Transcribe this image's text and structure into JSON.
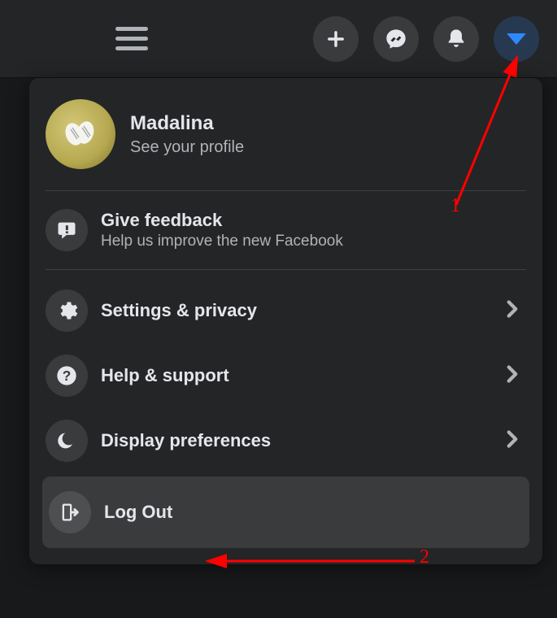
{
  "topbar": {
    "menu_icon": "hamburger",
    "buttons": [
      "create",
      "messenger",
      "notifications",
      "account"
    ]
  },
  "profile": {
    "name": "Madalina",
    "subtitle": "See your profile"
  },
  "feedback": {
    "title": "Give feedback",
    "subtitle": "Help us improve the new Facebook"
  },
  "menu": [
    {
      "icon": "gear",
      "label": "Settings & privacy",
      "chevron": true
    },
    {
      "icon": "question",
      "label": "Help & support",
      "chevron": true
    },
    {
      "icon": "moon",
      "label": "Display preferences",
      "chevron": true
    }
  ],
  "logout": {
    "label": "Log Out"
  },
  "annotations": {
    "arrow1_label": "1",
    "arrow2_label": "2"
  }
}
